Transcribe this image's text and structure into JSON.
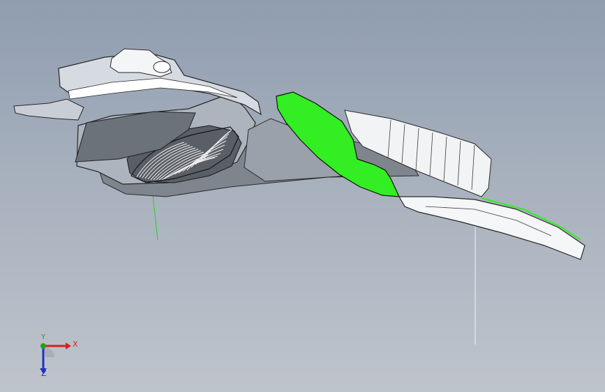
{
  "viewport": {
    "background_top": "#8f9db0",
    "background_bottom": "#bfc4cc",
    "highlight_color": "#33ee22",
    "sketch_line_color": "#22cc22"
  },
  "model": {
    "icon": "cad-part-section-view"
  },
  "triad": {
    "x_label": "X",
    "y_label": "Y",
    "z_label": "Z",
    "x_color": "#d42020",
    "y_color": "#20a020",
    "z_color": "#2030c0"
  }
}
